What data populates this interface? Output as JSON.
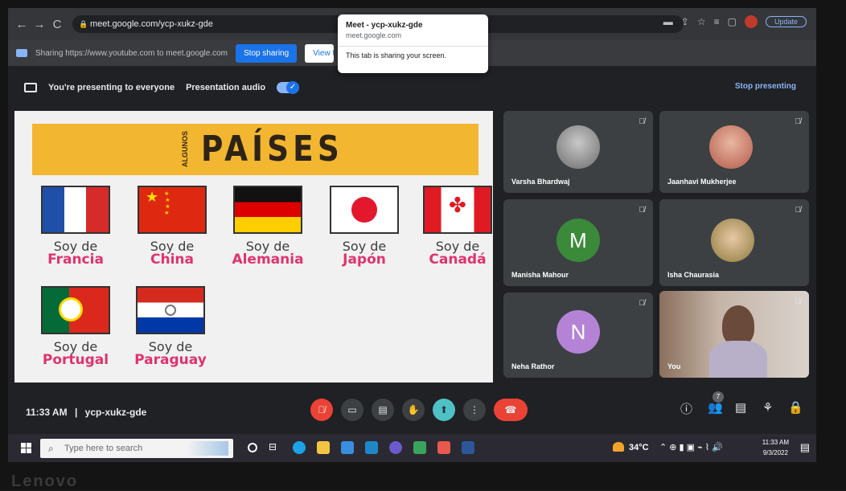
{
  "browser": {
    "url": "meet.google.com/ycp-xukz-gde",
    "update_label": "Update"
  },
  "sharebar": {
    "text": "Sharing https://www.youtube.com to meet.google.com",
    "stop_label": "Stop sharing",
    "view_label": "View tab"
  },
  "popup": {
    "title": "Meet - ycp-xukz-gde",
    "domain": "meet.google.com",
    "message": "This tab is sharing your screen."
  },
  "meet": {
    "presenting_text": "You're presenting to everyone",
    "audio_label": "Presentation audio",
    "stop_presenting": "Stop presenting",
    "time": "11:33 AM",
    "separator": "|",
    "meeting_code": "ycp-xukz-gde",
    "people_count": "7"
  },
  "slide": {
    "algunos": "ALGUNOS",
    "title": "PAÍSES",
    "countries": [
      {
        "soy": "Soy de",
        "name": "Francia"
      },
      {
        "soy": "Soy de",
        "name": "China"
      },
      {
        "soy": "Soy de",
        "name": "Alemania"
      },
      {
        "soy": "Soy de",
        "name": "Japón"
      },
      {
        "soy": "Soy de",
        "name": "Canadá"
      },
      {
        "soy": "Soy de",
        "name": "Portugal"
      },
      {
        "soy": "Soy de",
        "name": "Paraguay"
      }
    ]
  },
  "participants": [
    {
      "name": "Varsha Bhardwaj"
    },
    {
      "name": "Jaanhavi Mukherjee"
    },
    {
      "name": "Manisha Mahour",
      "initial": "M",
      "color": "#3a8a3a"
    },
    {
      "name": "Isha Chaurasia"
    },
    {
      "name": "Neha Rathor",
      "initial": "N",
      "color": "#b583d6"
    },
    {
      "name": "You"
    }
  ],
  "taskbar": {
    "search_placeholder": "Type here to search",
    "temperature": "34°C",
    "time": "11:33 AM",
    "date": "9/3/2022"
  }
}
